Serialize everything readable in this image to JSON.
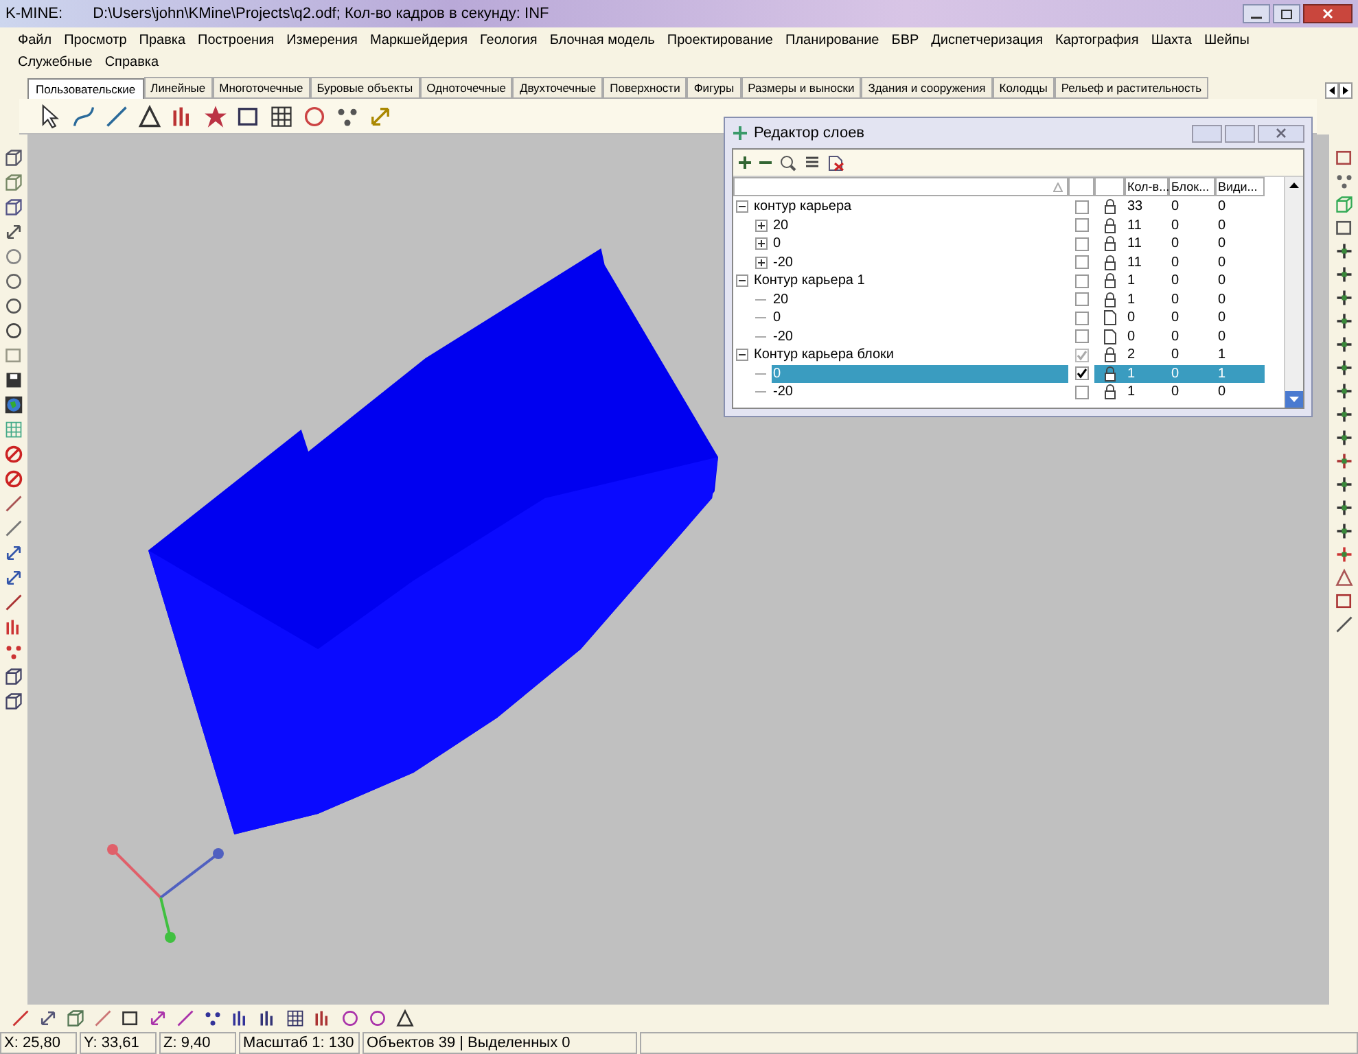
{
  "window": {
    "app": "K-MINE:",
    "title": "D:\\Users\\john\\KMine\\Projects\\q2.odf; Кол-во кадров в секунду: INF"
  },
  "menu": [
    "Файл",
    "Просмотр",
    "Правка",
    "Построения",
    "Измерения",
    "Маркшейдерия",
    "Геология",
    "Блочная модель",
    "Проектирование",
    "Планирование",
    "БВР",
    "Диспетчеризация",
    "Картография",
    "Шахта",
    "Шейпы",
    "Служебные",
    "Справка"
  ],
  "tabs": [
    {
      "label": "Пользовательские",
      "selected": true
    },
    {
      "label": "Линейные",
      "selected": false
    },
    {
      "label": "Многоточечные",
      "selected": false
    },
    {
      "label": "Буровые объекты",
      "selected": false
    },
    {
      "label": "Одноточечные",
      "selected": false
    },
    {
      "label": "Двухточечные",
      "selected": false
    },
    {
      "label": "Поверхности",
      "selected": false
    },
    {
      "label": "Фигуры",
      "selected": false
    },
    {
      "label": "Размеры и выноски",
      "selected": false
    },
    {
      "label": "Здания и сооружения",
      "selected": false
    },
    {
      "label": "Колодцы",
      "selected": false
    },
    {
      "label": "Рельеф и растительность",
      "selected": false
    }
  ],
  "layer_editor": {
    "title": "Редактор слоев",
    "columns": [
      "Кол-в...",
      "Блок...",
      "Види..."
    ],
    "layers": [
      {
        "label": "контур карьера",
        "expanded": true,
        "checked": false,
        "greyed": false,
        "kind": "locked",
        "count": "33",
        "blocks": "0",
        "visible": "0",
        "selected": false,
        "children": [
          {
            "label": "20",
            "expanded": false,
            "checked": false,
            "greyed": false,
            "kind": "locked",
            "count": "11",
            "blocks": "0",
            "visible": "0",
            "selected": false
          },
          {
            "label": "0",
            "expanded": false,
            "checked": false,
            "greyed": false,
            "kind": "locked",
            "count": "11",
            "blocks": "0",
            "visible": "0",
            "selected": false
          },
          {
            "label": "-20",
            "expanded": false,
            "checked": false,
            "greyed": false,
            "kind": "locked",
            "count": "11",
            "blocks": "0",
            "visible": "0",
            "selected": false
          }
        ]
      },
      {
        "label": "Контур карьера 1",
        "expanded": true,
        "checked": false,
        "greyed": false,
        "kind": "locked",
        "count": "1",
        "blocks": "0",
        "visible": "0",
        "selected": false,
        "children": [
          {
            "label": "20",
            "checked": false,
            "greyed": false,
            "kind": "locked",
            "count": "1",
            "blocks": "0",
            "visible": "0",
            "selected": false
          },
          {
            "label": "0",
            "checked": false,
            "greyed": false,
            "kind": "empty",
            "count": "0",
            "blocks": "0",
            "visible": "0",
            "selected": false
          },
          {
            "label": "-20",
            "checked": false,
            "greyed": false,
            "kind": "empty",
            "count": "0",
            "blocks": "0",
            "visible": "0",
            "selected": false
          }
        ]
      },
      {
        "label": "Контур карьера блоки",
        "expanded": true,
        "checked": true,
        "greyed": true,
        "kind": "locked",
        "count": "2",
        "blocks": "0",
        "visible": "1",
        "selected": false,
        "children": [
          {
            "label": "0",
            "checked": true,
            "greyed": false,
            "kind": "locked",
            "count": "1",
            "blocks": "0",
            "visible": "1",
            "selected": true
          },
          {
            "label": "-20",
            "checked": false,
            "greyed": false,
            "kind": "locked",
            "count": "1",
            "blocks": "0",
            "visible": "0",
            "selected": false
          }
        ]
      }
    ]
  },
  "status_bar": [
    "X: 25,80",
    "Y: 33,61",
    "Z: 9,40",
    "Масштаб 1: 130",
    "Объектов 39 | Выделенных 0"
  ]
}
